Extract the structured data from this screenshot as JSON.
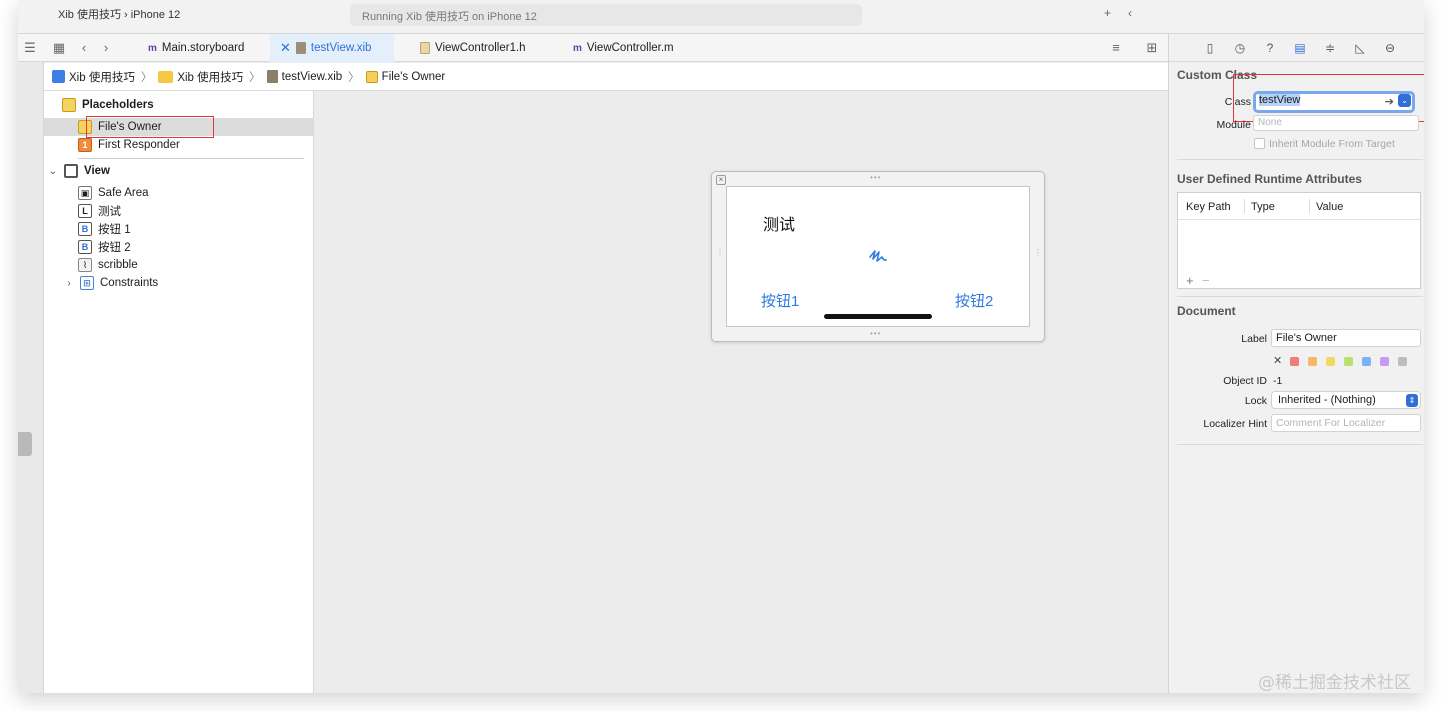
{
  "window": {
    "scheme": "Xib 使用技巧 › iPhone 12",
    "activity": "Running Xib 使用技巧 on iPhone 12"
  },
  "tabs": [
    {
      "label": "Main.storyboard",
      "active": false
    },
    {
      "label": "testView.xib",
      "active": true
    },
    {
      "label": "ViewController1.h",
      "active": false
    },
    {
      "label": "ViewController.m",
      "active": false
    }
  ],
  "breadcrumb": [
    "Xib 使用技巧",
    "Xib 使用技巧",
    "testView.xib",
    "File's Owner"
  ],
  "outline": {
    "placeholders_header": "Placeholders",
    "files_owner": "File's Owner",
    "first_responder": "First Responder",
    "view": "View",
    "children": [
      "Safe Area",
      "测试",
      "按钮 1",
      "按钮 2",
      "scribble",
      "Constraints"
    ]
  },
  "canvas": {
    "label_text": "测试",
    "button1": "按钮1",
    "button2": "按钮2"
  },
  "inspector": {
    "custom_class": {
      "title": "Custom Class",
      "class_label": "Class",
      "class_value": "testView",
      "module_label": "Module",
      "module_placeholder": "None",
      "inherit_label": "Inherit Module From Target"
    },
    "udra": {
      "title": "User Defined Runtime Attributes",
      "columns": [
        "Key Path",
        "Type",
        "Value"
      ],
      "add": "+",
      "remove": "−"
    },
    "document": {
      "title": "Document",
      "label_label": "Label",
      "label_value": "File's Owner",
      "object_id_label": "Object ID",
      "object_id_value": "-1",
      "lock_label": "Lock",
      "lock_value": "Inherited - (Nothing)",
      "hint_label": "Localizer Hint",
      "hint_placeholder": "Comment For Localizer"
    },
    "swatch_colors": [
      "#f07b7b",
      "#f3b86a",
      "#f1d865",
      "#b9e06b",
      "#79b3f2",
      "#c69af0",
      "#bdbdbd"
    ]
  },
  "watermark": "@稀土掘金技术社区"
}
